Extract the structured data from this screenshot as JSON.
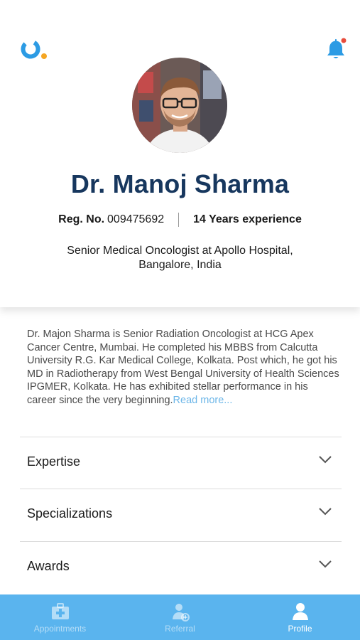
{
  "doctor": {
    "name": "Dr. Manoj Sharma",
    "reg_label": "Reg. No.",
    "reg_value": "009475692",
    "experience": "14 Years experience",
    "designation": "Senior Medical Oncologist at Apollo Hospital, Bangalore, India"
  },
  "bio": {
    "text": "Dr. Majon Sharma is Senior Radiation Oncologist at HCG Apex Cancer Centre, Mumbai. He completed his MBBS from Calcutta University R.G. Kar Medical College, Kolkata. Post which, he got his MD in Radiotherapy from West Bengal University of Health Sciences IPGMER, Kolkata. He has exhibited stellar performance in his career since the very beginning.",
    "read_more": "Read more..."
  },
  "sections": [
    {
      "label": "Expertise",
      "icon": "chevron-down-icon"
    },
    {
      "label": "Specializations",
      "icon": "chevron-down-icon"
    },
    {
      "label": "Awards",
      "icon": "chevron-down-icon"
    }
  ],
  "tabs": [
    {
      "label": "Appointments",
      "icon": "medical-kit-icon",
      "active": false
    },
    {
      "label": "Referral",
      "icon": "add-user-icon",
      "active": false
    },
    {
      "label": "Profile",
      "icon": "user-icon",
      "active": true
    }
  ],
  "header": {
    "logo_icon": "app-logo-icon",
    "notification_icon": "bell-icon",
    "has_unread": true
  },
  "colors": {
    "accent": "#2c9be4",
    "name": "#17375e",
    "link": "#6cb6e8",
    "tabbar": "#5ab4ee",
    "badge": "#e74c3c",
    "logo_dot": "#f5a623"
  }
}
